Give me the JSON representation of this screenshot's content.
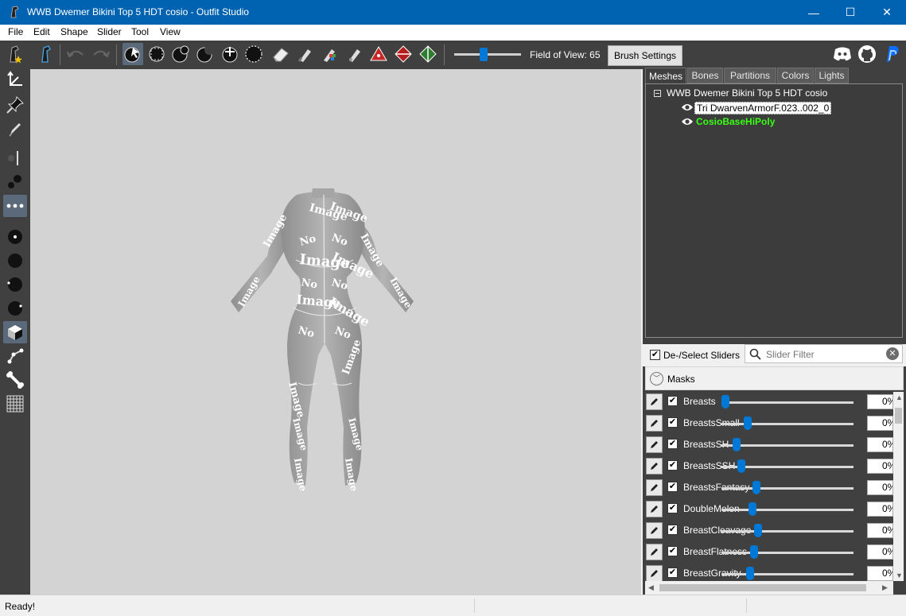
{
  "window": {
    "title": "WWB Dwemer Bikini Top 5 HDT cosio - Outfit Studio",
    "minimize": "—",
    "maximize": "☐",
    "close": "✕"
  },
  "menu": [
    "File",
    "Edit",
    "Shape",
    "Slider",
    "Tool",
    "View"
  ],
  "toolbar": {
    "field_of_view_label": "Field of View: 65",
    "field_of_view_value": 65,
    "brush_settings": "Brush Settings"
  },
  "viewport": {
    "texture_placeholder_word1": "No",
    "texture_placeholder_word2": "Image"
  },
  "tabs": [
    "Meshes",
    "Bones",
    "Partitions",
    "Colors",
    "Lights"
  ],
  "meshes": {
    "project": "WWB Dwemer Bikini Top 5 HDT cosio",
    "items": [
      {
        "name": "Tri DwarvenArmorF.023..002_0",
        "state": "selected"
      },
      {
        "name": "CosioBaseHiPoly",
        "state": "reference"
      }
    ]
  },
  "sliders_panel": {
    "select_label": "De-/Select Sliders",
    "filter_placeholder": "Slider Filter",
    "masks_label": "Masks",
    "sliders": [
      {
        "name": "Breasts",
        "value_text": "0%",
        "level": 0.0
      },
      {
        "name": "BreastsSmall",
        "value_text": "0%",
        "level": 0.18
      },
      {
        "name": "BreastsSH",
        "value_text": "0%",
        "level": 0.09
      },
      {
        "name": "BreastsSSH",
        "value_text": "0%",
        "level": 0.13
      },
      {
        "name": "BreastsFantasy",
        "value_text": "0%",
        "level": 0.25
      },
      {
        "name": "DoubleMelon",
        "value_text": "0%",
        "level": 0.22
      },
      {
        "name": "BreastCleavage",
        "value_text": "0%",
        "level": 0.26
      },
      {
        "name": "BreastFlatness",
        "value_text": "0%",
        "level": 0.23
      },
      {
        "name": "BreastGravity",
        "value_text": "0%",
        "level": 0.2
      }
    ]
  },
  "status": {
    "text": "Ready!"
  }
}
